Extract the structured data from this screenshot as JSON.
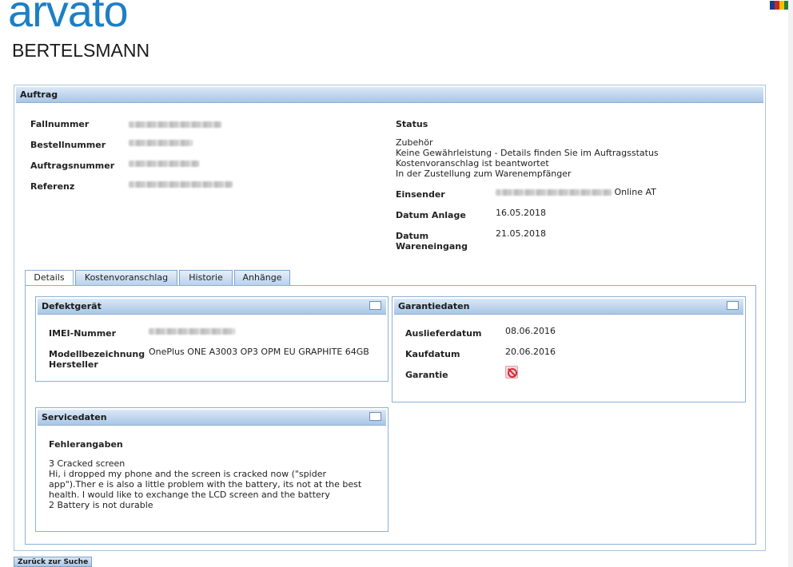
{
  "logo": {
    "brand": "arvato",
    "parent": "BERTELSMANN"
  },
  "order": {
    "title": "Auftrag",
    "fallnummer_label": "Fallnummer",
    "bestellnummer_label": "Bestellnummer",
    "auftragsnummer_label": "Auftragsnummer",
    "referenz_label": "Referenz",
    "status_label": "Status",
    "status_lines": "Zubehör\nKeine Gewährleistung - Details finden Sie im Auftragsstatus\nKostenvoranschlag ist beantwortet\nIn der Zustellung zum Warenempfänger",
    "einsender_label": "Einsender",
    "einsender_suffix": "Online AT",
    "datum_anlage_label": "Datum Anlage",
    "datum_anlage": "16.05.2018",
    "datum_wareneingang_label": "Datum\nWareneingang",
    "datum_wareneingang": "21.05.2018"
  },
  "tabs": [
    "Details",
    "Kostenvoranschlag",
    "Historie",
    "Anhänge"
  ],
  "device": {
    "title": "Defektgerät",
    "imei_label": "IMEI-Nummer",
    "model_label": "Modellbezeichnung\nHersteller",
    "model": "OnePlus ONE A3003 OP3 OPM EU GRAPHITE 64GB"
  },
  "warranty": {
    "title": "Garantiedaten",
    "auslieferdatum_label": "Auslieferdatum",
    "auslieferdatum": "08.06.2016",
    "kaufdatum_label": "Kaufdatum",
    "kaufdatum": "20.06.2016",
    "garantie_label": "Garantie",
    "garantie_icon": "no-entry-icon"
  },
  "service": {
    "title": "Servicedaten",
    "fehler_label": "Fehlerangaben",
    "fehler_text": "3 Cracked screen\nHi, i dropped my phone and the screen is cracked now (\"spider\napp\").Ther e is also a little problem with the battery, its not at the best\nhealth. I would like to exchange the LCD screen and the battery\n2 Battery is not durable"
  },
  "back_button": "Zurück zur Suche",
  "colors": {
    "brand_blue": "#1d7fc4",
    "header_gradient_top": "#dbe8f6",
    "header_gradient_bottom": "#a8c6e6",
    "border": "#8eb0d5"
  }
}
